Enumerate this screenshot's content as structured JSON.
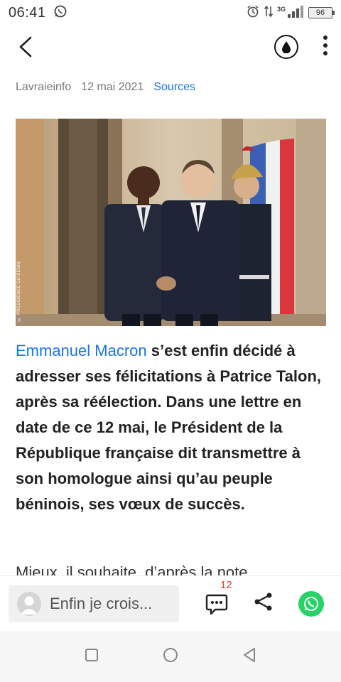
{
  "status_bar": {
    "time": "06:41",
    "network": "3G",
    "battery": "96"
  },
  "meta": {
    "source": "Lavraieinfo",
    "date": "12 mai 2021",
    "sources_link": "Sources"
  },
  "photo": {
    "credit": "© PRÉSIDENCE DU BÉNIN"
  },
  "article": {
    "link_text": "Emmanuel Macron",
    "lead": " s’est enfin décidé à adresser ses félicitations à Patrice Talon, après sa réélection. Dans une lettre en date de ce 12 mai, le Président de la République française dit transmettre à son homologue ainsi qu’au peuple béninois, ses vœux de succès.",
    "next_paragraph": "Mieux, il souhaite, d’après la note"
  },
  "bottom_bar": {
    "comment_placeholder": "Enfin je crois...",
    "comment_count": "12"
  },
  "colors": {
    "link": "#1a73e8",
    "badge": "#e53935",
    "whatsapp": "#25d366"
  }
}
